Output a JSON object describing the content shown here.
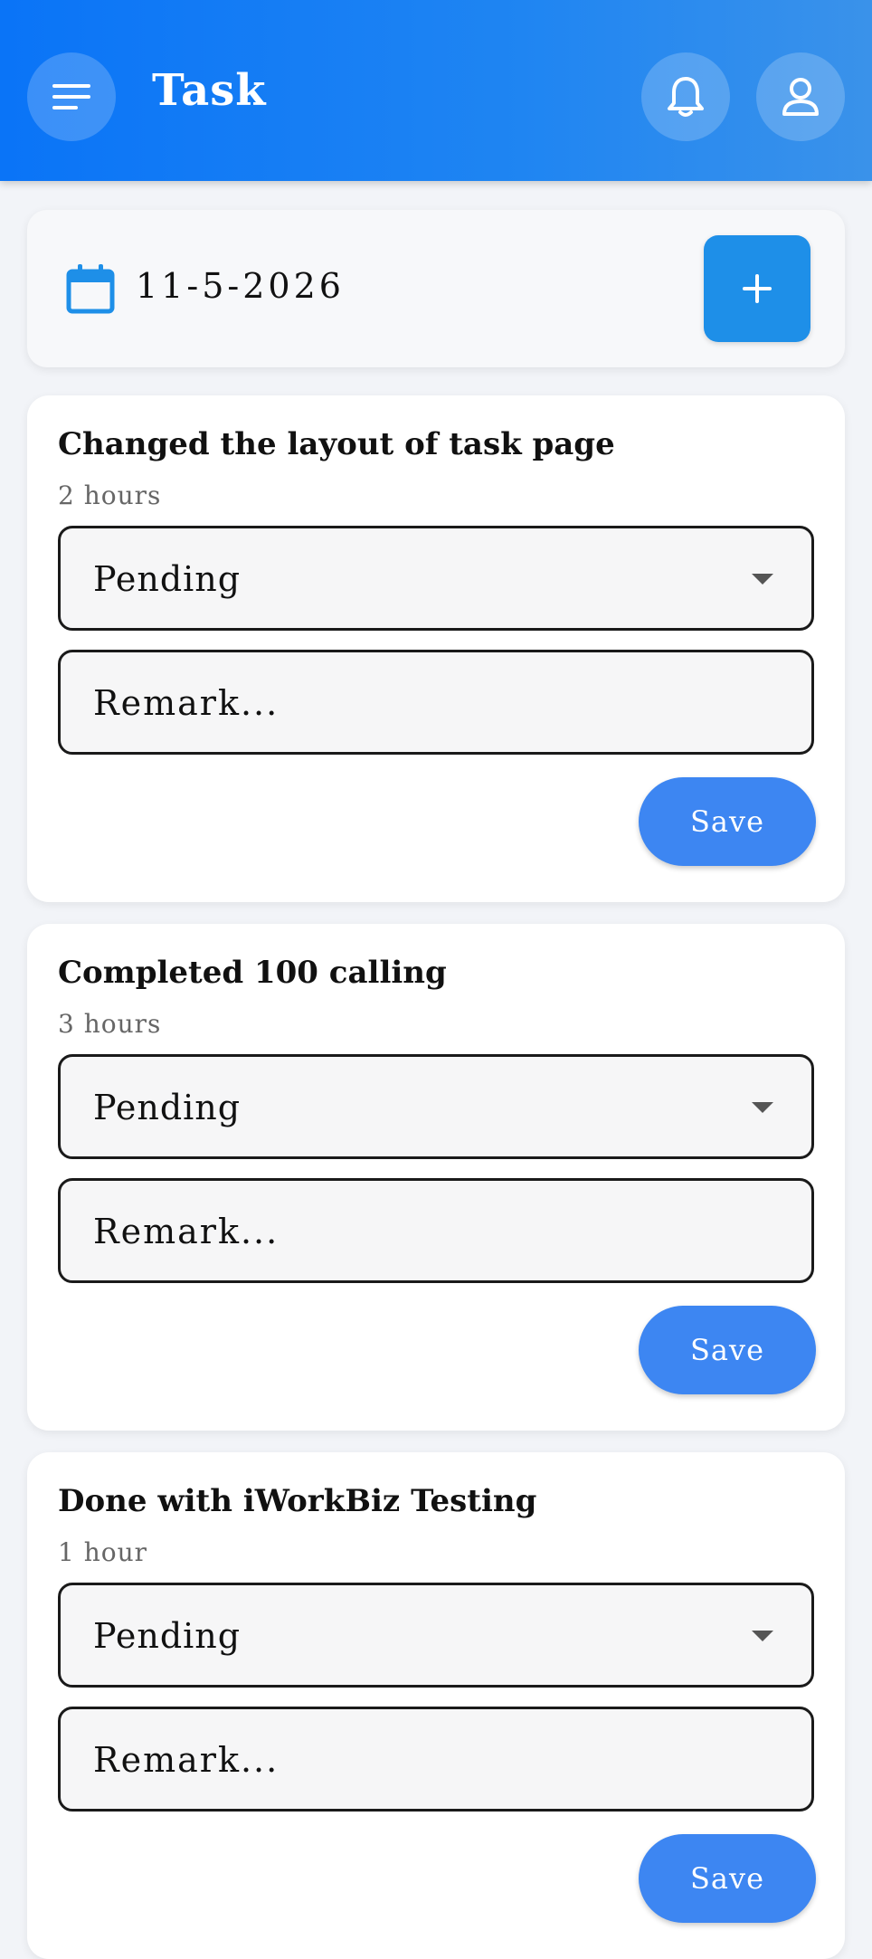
{
  "header": {
    "title": "Task",
    "color": "#0a74f7",
    "icons": [
      "menu-icon",
      "bell-icon",
      "user-icon"
    ]
  },
  "date_bar": {
    "date": "11-5-2026",
    "icon": "calendar-icon",
    "add_icon": "plus-icon",
    "accent": "#1e8fe8"
  },
  "tasks": [
    {
      "title": "Changed the layout of task page",
      "duration": "2 hours",
      "status": "Pending",
      "remark_placeholder": "Remark...",
      "save_label": "Save"
    },
    {
      "title": "Completed 100 calling",
      "duration": "3 hours",
      "status": "Pending",
      "remark_placeholder": "Remark...",
      "save_label": "Save"
    },
    {
      "title": "Done with iWorkBiz Testing",
      "duration": "1 hour",
      "status": "Pending",
      "remark_placeholder": "Remark...",
      "save_label": "Save"
    }
  ]
}
